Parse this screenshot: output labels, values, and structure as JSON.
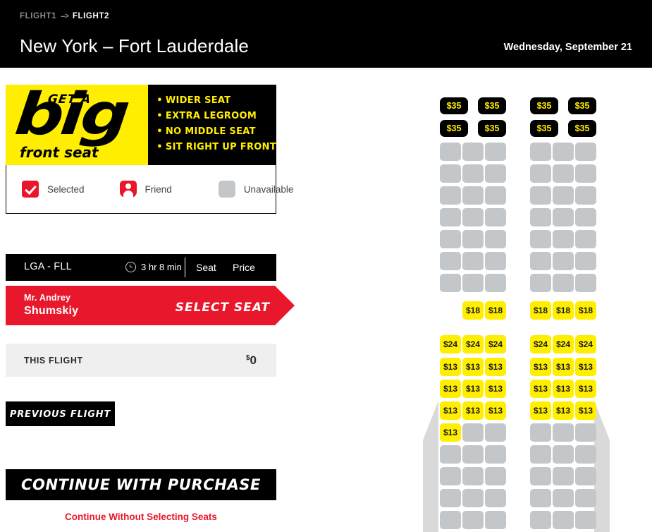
{
  "header": {
    "breadcrumb": {
      "previous": "FLIGHT1",
      "arrow": "-->",
      "current": "FLIGHT2"
    },
    "route_title": "New York – Fort Lauderdale",
    "date": "Wednesday, September 21"
  },
  "promo": {
    "get_a": "GET A",
    "big": "big",
    "front_seat": "front seat",
    "bullets": [
      "WIDER SEAT",
      "EXTRA LEGROOM",
      "NO MIDDLE SEAT",
      "SIT RIGHT UP FRONT"
    ],
    "bullet_dot": "•"
  },
  "legend": {
    "items": [
      {
        "icon": "checkbox-icon",
        "label": "Selected"
      },
      {
        "icon": "person-icon",
        "label": "Friend"
      },
      {
        "icon": "blank-seat-icon",
        "label": "Unavailable"
      }
    ]
  },
  "flight_bar": {
    "route": "LGA - FLL",
    "duration": "3 hr 8 min",
    "col_seat": "Seat",
    "col_price": "Price"
  },
  "passenger": {
    "title": "Mr. Andrey",
    "name": "Shumskiy",
    "action": "SELECT SEAT"
  },
  "totals": {
    "label": "THIS FLIGHT",
    "currency": "$",
    "amount": "0"
  },
  "buttons": {
    "previous_flight": "PREVIOUS FLIGHT",
    "continue_with_purchase": "CONTINUE WITH PURCHASE",
    "continue_without_seats": "Continue Without Selecting Seats"
  },
  "colors": {
    "accent_red": "#E8172B",
    "promo_yellow": "#FFEE00",
    "seat_unavailable": "#C3C7CA",
    "seat_available": "#FFEE00",
    "seat_premium": "#000000",
    "wing_gray": "#D9D9D9"
  },
  "seatmap": {
    "rows": [
      {
        "type": "premium",
        "left": [
          "$35",
          "$35"
        ],
        "right": [
          "$35",
          "$35"
        ]
      },
      {
        "type": "premium",
        "left": [
          "$35",
          "$35"
        ],
        "right": [
          "$35",
          "$35"
        ]
      },
      {
        "type": "standard",
        "left": [
          null,
          null,
          null
        ],
        "right": [
          null,
          null,
          null
        ]
      },
      {
        "type": "standard",
        "left": [
          null,
          null,
          null
        ],
        "right": [
          null,
          null,
          null
        ]
      },
      {
        "type": "standard",
        "left": [
          null,
          null,
          null
        ],
        "right": [
          null,
          null,
          null
        ]
      },
      {
        "type": "standard",
        "left": [
          null,
          null,
          null
        ],
        "right": [
          null,
          null,
          null
        ]
      },
      {
        "type": "standard",
        "left": [
          null,
          null,
          null
        ],
        "right": [
          null,
          null,
          null
        ]
      },
      {
        "type": "standard",
        "left": [
          null,
          null,
          null
        ],
        "right": [
          null,
          null,
          null
        ]
      },
      {
        "type": "standard",
        "left": [
          null,
          null,
          null
        ],
        "right": [
          null,
          null,
          null
        ]
      },
      {
        "type": "standard",
        "left": [
          "",
          "$18",
          "$18"
        ],
        "right": [
          "$18",
          "$18",
          "$18"
        ]
      },
      {
        "type": "standard",
        "left": [
          "$24",
          "$24",
          "$24"
        ],
        "right": [
          "$24",
          "$24",
          "$24"
        ]
      },
      {
        "type": "standard",
        "left": [
          "$13",
          "$13",
          "$13"
        ],
        "right": [
          "$13",
          "$13",
          "$13"
        ]
      },
      {
        "type": "standard",
        "left": [
          "$13",
          "$13",
          "$13"
        ],
        "right": [
          "$13",
          "$13",
          "$13"
        ]
      },
      {
        "type": "standard",
        "left": [
          "$13",
          "$13",
          "$13"
        ],
        "right": [
          "$13",
          "$13",
          "$13"
        ]
      },
      {
        "type": "standard",
        "left": [
          "$13",
          null,
          null
        ],
        "right": [
          null,
          null,
          null
        ]
      },
      {
        "type": "standard",
        "left": [
          null,
          null,
          null
        ],
        "right": [
          null,
          null,
          null
        ]
      },
      {
        "type": "standard",
        "left": [
          null,
          null,
          null
        ],
        "right": [
          null,
          null,
          null
        ]
      },
      {
        "type": "standard",
        "left": [
          null,
          null,
          null
        ],
        "right": [
          null,
          null,
          null
        ]
      },
      {
        "type": "standard",
        "left": [
          null,
          null,
          null
        ],
        "right": [
          null,
          null,
          null
        ]
      }
    ]
  }
}
